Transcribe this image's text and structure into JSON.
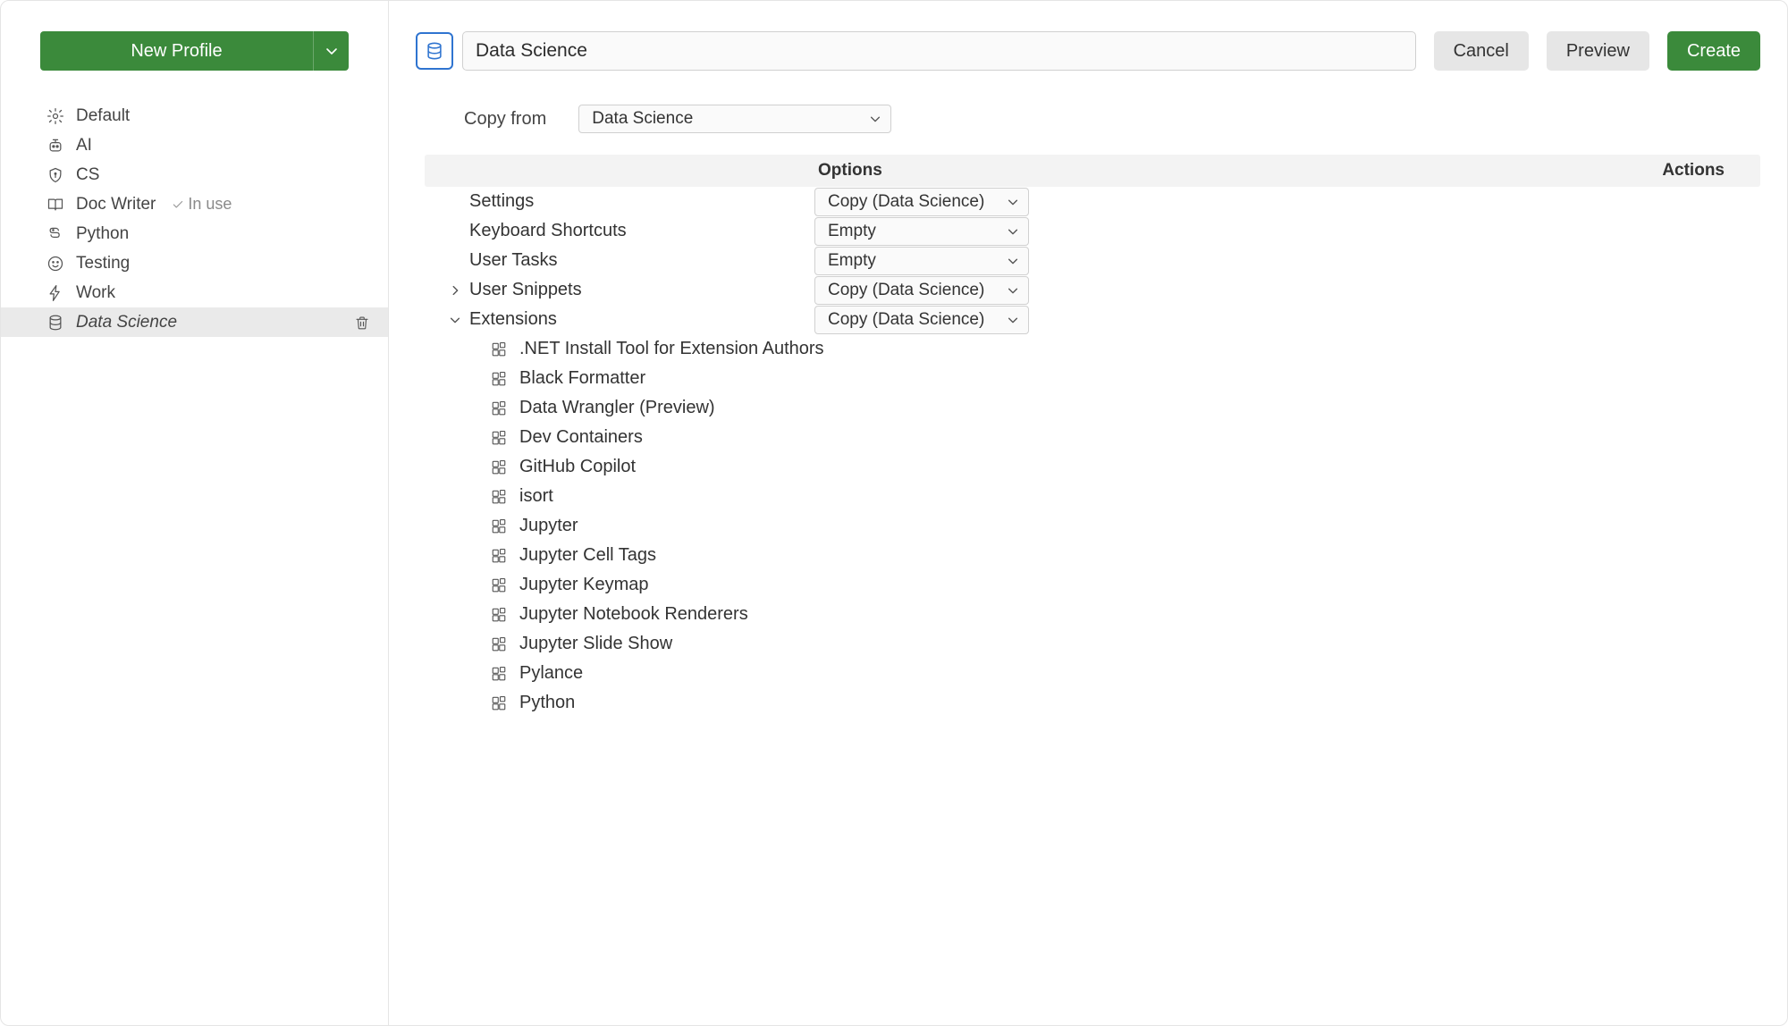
{
  "colors": {
    "accent_green": "#3b8a3b",
    "focus_blue": "#2f74d0"
  },
  "sidebar": {
    "new_profile_label": "New Profile",
    "items": [
      {
        "name": "default",
        "label": "Default",
        "icon": "gear-icon",
        "in_use": false,
        "active": false
      },
      {
        "name": "ai",
        "label": "AI",
        "icon": "robot-icon",
        "in_use": false,
        "active": false
      },
      {
        "name": "cs",
        "label": "CS",
        "icon": "shield-icon",
        "in_use": false,
        "active": false
      },
      {
        "name": "doc-writer",
        "label": "Doc Writer",
        "icon": "book-icon",
        "in_use": true,
        "active": false
      },
      {
        "name": "python",
        "label": "Python",
        "icon": "snake-icon",
        "in_use": false,
        "active": false
      },
      {
        "name": "testing",
        "label": "Testing",
        "icon": "smiley-icon",
        "in_use": false,
        "active": false
      },
      {
        "name": "work",
        "label": "Work",
        "icon": "lightning-icon",
        "in_use": false,
        "active": false
      },
      {
        "name": "data-science",
        "label": "Data Science",
        "icon": "database-icon",
        "in_use": false,
        "active": true
      }
    ],
    "in_use_label": "In use"
  },
  "header": {
    "profile_name_value": "Data Science",
    "cancel_label": "Cancel",
    "preview_label": "Preview",
    "create_label": "Create",
    "selected_icon": "database-icon"
  },
  "copy_from": {
    "label": "Copy from",
    "selected": "Data Science"
  },
  "table": {
    "col_options": "Options",
    "col_actions": "Actions"
  },
  "config_rows": [
    {
      "key": "settings",
      "label": "Settings",
      "expandable": false,
      "expanded": false,
      "option": "Copy (Data Science)"
    },
    {
      "key": "keyboard",
      "label": "Keyboard Shortcuts",
      "expandable": false,
      "expanded": false,
      "option": "Empty"
    },
    {
      "key": "tasks",
      "label": "User Tasks",
      "expandable": false,
      "expanded": false,
      "option": "Empty"
    },
    {
      "key": "snippets",
      "label": "User Snippets",
      "expandable": true,
      "expanded": false,
      "option": "Copy (Data Science)"
    },
    {
      "key": "extensions",
      "label": "Extensions",
      "expandable": true,
      "expanded": true,
      "option": "Copy (Data Science)"
    }
  ],
  "extensions_list": [
    ".NET Install Tool for Extension Authors",
    "Black Formatter",
    "Data Wrangler (Preview)",
    "Dev Containers",
    "GitHub Copilot",
    "isort",
    "Jupyter",
    "Jupyter Cell Tags",
    "Jupyter Keymap",
    "Jupyter Notebook Renderers",
    "Jupyter Slide Show",
    "Pylance",
    "Python"
  ]
}
